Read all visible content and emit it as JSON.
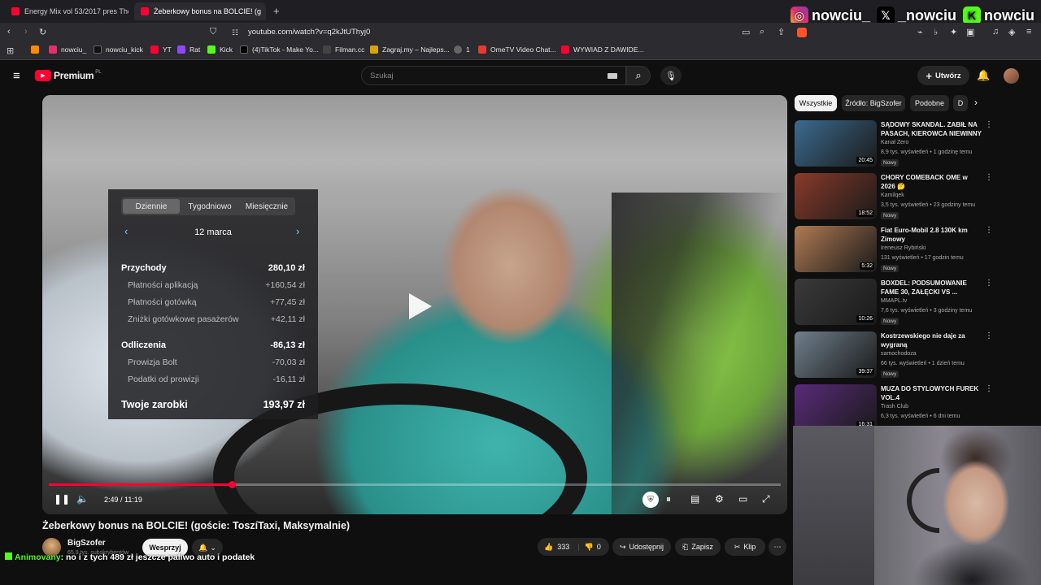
{
  "browser": {
    "tabs": [
      {
        "label": "Energy Mix vol 53/2017 pres The"
      },
      {
        "label": "Żeberkowy bonus na BOLCIE! (g"
      }
    ],
    "url": "youtube.com/watch?v=q2kJtUThyj0",
    "bookmarks": [
      {
        "label": "nowciu_",
        "color": "#e1306c"
      },
      {
        "label": "nowciu_kick",
        "color": "#111111"
      },
      {
        "label": "YT",
        "color": "#ff0033"
      },
      {
        "label": "Rat",
        "color": "#9146ff"
      },
      {
        "label": "Kick",
        "color": "#53fc18"
      },
      {
        "label": "(4)TikTok - Make Yo...",
        "color": "#000000"
      },
      {
        "label": "Filman.cc",
        "color": "#444444"
      },
      {
        "label": "Zagraj.my – Najleps...",
        "color": "#d9a300"
      },
      {
        "label": "1",
        "color": "#666666"
      },
      {
        "label": "OmeTV Video Chat...",
        "color": "#e33b2e"
      },
      {
        "label": "WYWIAD Z DAWIDE...",
        "color": "#ff0033"
      }
    ]
  },
  "socials": [
    {
      "label": "nowciu_",
      "icon": "instagram-icon",
      "color": "#e1306c"
    },
    {
      "label": "_nowciu",
      "icon": "x-icon",
      "color": "#000000"
    },
    {
      "label": "nowciu",
      "icon": "kick-icon",
      "color": "#53fc18"
    }
  ],
  "youtube": {
    "logo_text": "Premium",
    "logo_sup": "PL",
    "search_placeholder": "Szukaj",
    "create_label": "Utwórz"
  },
  "video": {
    "earnings": {
      "tabs": [
        "Dziennie",
        "Tygodniowo",
        "Miesięcznie"
      ],
      "date": "12 marca",
      "rows": [
        {
          "label": "Przychody",
          "value": "280,10 zł",
          "kind": "bold"
        },
        {
          "label": "Płatności aplikacją",
          "value": "+160,54 zł",
          "kind": "sub"
        },
        {
          "label": "Płatności gotówką",
          "value": "+77,45 zł",
          "kind": "sub"
        },
        {
          "label": "Zniżki gotówkowe pasażerów",
          "value": "+42,11 zł",
          "kind": "sub"
        },
        {
          "label": "Odliczenia",
          "value": "-86,13 zł",
          "kind": "bold"
        },
        {
          "label": "Prowizja Bolt",
          "value": "-70,03 zł",
          "kind": "sub"
        },
        {
          "label": "Podatki od prowizji",
          "value": "-16,11 zł",
          "kind": "sub"
        }
      ],
      "total_label": "Twoje zarobki",
      "total_value": "193,97 zł"
    },
    "time": "2:49 / 11:19",
    "progress": 0.25,
    "title": "Żeberkowy bonus na BOLCIE! (goście: ToszíTaxi, Maksymalnie)",
    "channel": "BigSzofer",
    "subscribers": "65,9 tys. subskrybentów",
    "support_label": "Wesprzyj",
    "likes": "333",
    "dislikes": "0",
    "share_label": "Udostępnij",
    "save_label": "Zapisz",
    "clip_label": "Klip"
  },
  "sidebar": {
    "chips": [
      "Wszystkie",
      "Źródło: BigSzofer",
      "Podobne",
      "D"
    ],
    "items": [
      {
        "title": "SĄDOWY SKANDAL. ZABIŁ NA PASACH, KIEROWCA NIEWINNY",
        "channel": "Kanał Zero",
        "meta": "8,9 tys. wyświetleń • 1 godzinę temu",
        "badge": "Nowy",
        "duration": "20:45",
        "thumb": "#3b6b8f"
      },
      {
        "title": "CHORY COMEBACK OME w 2026 🤔",
        "channel": "Kamilqek",
        "meta": "3,5 tys. wyświetleń • 23 godziny temu",
        "badge": "Nowy",
        "duration": "18:52",
        "thumb": "#8a3a2a"
      },
      {
        "title": "Fiat Euro-Mobil 2.8 130K km Zimowy",
        "channel": "Ireneusz Rybiński",
        "meta": "131 wyświetleń • 17 godzin temu",
        "badge": "Nowy",
        "duration": "5:32",
        "thumb": "#b07a52"
      },
      {
        "title": "BOXDEL: PODSUMOWANIE FAME 30, ZAŁĘCKI VS ...",
        "channel": "MMAPL.tv",
        "meta": "7,6 tys. wyświetleń • 3 godziny temu",
        "badge": "Nowy",
        "duration": "10:26",
        "thumb": "#3a3a3a"
      },
      {
        "title": "Kostrzewskiego nie daje za wygraną",
        "channel": "samochodoza",
        "meta": "66 tys. wyświetleń • 1 dzień temu",
        "badge": "Nowy",
        "duration": "39:37",
        "thumb": "#6f7f8c"
      },
      {
        "title": "MUZA DO STYLOWYCH FUREK VOL.4",
        "channel": "Trash Club",
        "meta": "6,3 tys. wyświetleń • 6 dni temu",
        "badge": "",
        "duration": "16:31",
        "thumb": "#5a2a7a"
      }
    ]
  },
  "chat": {
    "user": "Animovany",
    "message": ": no i z tych 489 zł jeszcze paliwo auto i podatek"
  }
}
